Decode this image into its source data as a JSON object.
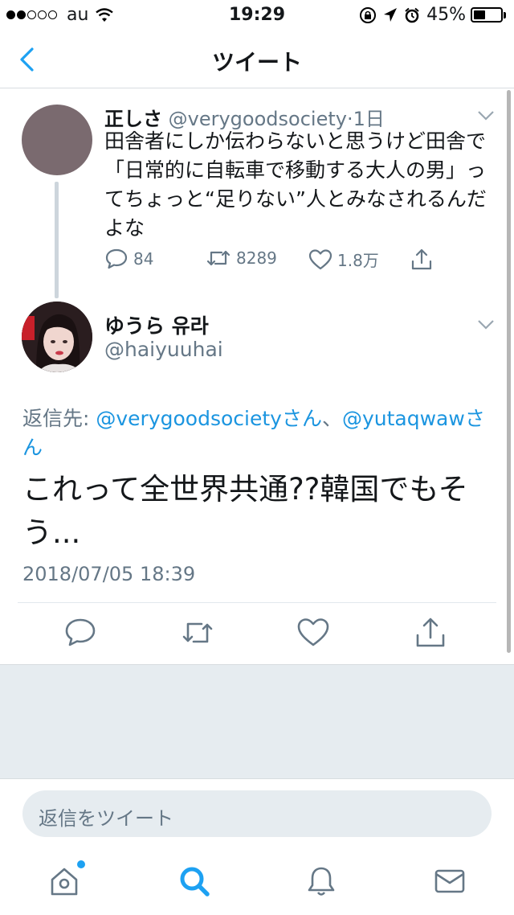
{
  "status_bar": {
    "carrier": "au",
    "time": "19:29",
    "battery": "45%",
    "battery_level": 0.45
  },
  "nav": {
    "title": "ツイート",
    "back_icon": "chevron-left-icon",
    "accent_color": "#1da1f2"
  },
  "parent_tweet": {
    "name": "正しさ",
    "handle": "@verygoodsociety",
    "separator": "·",
    "time": "1日",
    "text": "田舎者にしか伝わらないと思うけど田舎で「日常的に自転車で移動する大人の男」ってちょっと“足りない”人とみなされるんだよな",
    "reply_count": "84",
    "retweet_count": "8289",
    "like_count": "1.8万"
  },
  "main_tweet": {
    "name": "ゆうら 유라",
    "handle": "@haiyuuhai",
    "reply_prefix": "返信先: ",
    "mention1": "@verygoodsocietyさん",
    "mention_sep": "、",
    "mention2": "@yutaqwawさん",
    "text": "これって全世界共通??韓国でもそう...",
    "timestamp": "2018/07/05 18:39"
  },
  "reply_box": {
    "placeholder": "返信をツイート"
  },
  "tab_bar": {
    "tabs": [
      "home-icon",
      "search-icon",
      "notifications-icon",
      "messages-icon"
    ],
    "active": "search-icon"
  }
}
